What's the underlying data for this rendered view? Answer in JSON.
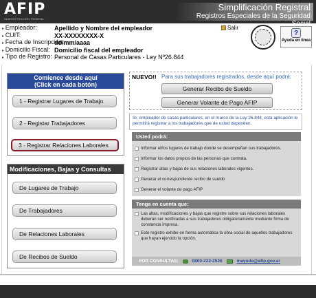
{
  "header": {
    "logo_text": "AFIP",
    "logo_sub": "ADMINISTRACIÓN FEDERAL",
    "title": "Simplificación Registral",
    "subtitle": "Registros Especiales de la Seguridad Social"
  },
  "info": {
    "rows": [
      {
        "label": "Empleador:",
        "value": "Apellido y Nombre del empleador",
        "bold": true
      },
      {
        "label": "CUIT:",
        "value": "XX-XXXXXXXX-X",
        "bold": true
      },
      {
        "label": "Fecha de Inscripción:",
        "value": "dd/mm/aaaa",
        "bold": true
      },
      {
        "label": "Domicilio Fiscal:",
        "value": "Domicilio fiscal del empleador",
        "bold": true
      },
      {
        "label": "Tipo de Registro:",
        "value": "Personal de Casas Particulares - Ley Nº26.844",
        "bold": false
      }
    ],
    "salir_label": "Salir",
    "help_label": "Ayuda en línea"
  },
  "left_panel": {
    "header_line1": "Comience desde aquí",
    "header_line2": "(Click en cada botón)",
    "buttons": [
      "1 - Registrar Lugares de Trabajo",
      "2 - Registar Trabajadores",
      "3 - Registrar Relaciones Laborales"
    ]
  },
  "mod_panel": {
    "header": "Modificaciones, Bajas y Consultas",
    "buttons": [
      "De Lugares de Trabajo",
      "De Trabajadores",
      "De Relaciones Laborales",
      "De Recibos de Sueldo"
    ]
  },
  "nuevo": {
    "title": "NUEVO!!",
    "text": "Para sus trabajadores registrados, desde aquí podrá:",
    "buttons": [
      "Generar Recibo de Sueldo",
      "Generar Volante de Pago AFIP"
    ]
  },
  "intro_text": "Sr. empleador de casas particulares, en el marco de la Ley 26.844, esta aplicación le permitirá registrar a los trabajadores que de usted dependen.",
  "usted": {
    "title": "Usted podrá:",
    "items": [
      "Informar el/los lugares de trabajo donde se desempeñan sus trabajadores.",
      "Informar los datos propios de las personas que contrata.",
      "Registrar altas y bajas de sus relaciones laborales vigentes.",
      "Generar el correspondiente recibo de sueldo",
      "Generar el volante de pago AFIP"
    ]
  },
  "tenga": {
    "title": "Tenga en cuenta que:",
    "paragraphs": [
      "Las altas, modificaciones y bajas que registre sobre sus relaciones laborales deberán ser notificadas a sus trabajadores obligatoriamente mediante firma de constancia impresa.",
      "Este registro exhibe en forma automática la obra social de aquellos trabajadores que hayan ejercido la opción."
    ],
    "consultas_label": "POR CONSULTAS:",
    "phone": "0800-222-2526",
    "email": "mayuda@afip.gov.ar"
  }
}
